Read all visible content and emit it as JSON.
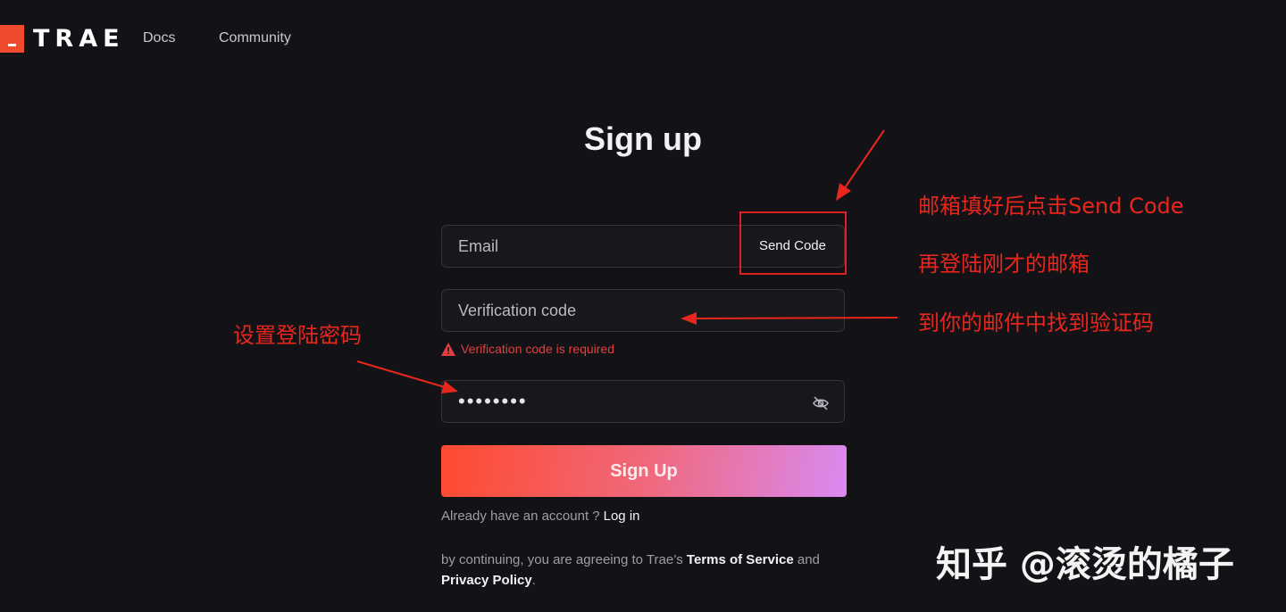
{
  "header": {
    "logo_text": "TRAE",
    "nav": [
      {
        "label": "Docs"
      },
      {
        "label": "Community"
      }
    ]
  },
  "form": {
    "title": "Sign up",
    "email_placeholder": "Email",
    "send_code_label": "Send Code",
    "code_placeholder": "Verification code",
    "code_error": "Verification code is required",
    "password_value": "••••••••",
    "submit_label": "Sign Up",
    "already_text": "Already have an account ?",
    "login_label": "Log in",
    "terms_prefix": "by continuing, you are agreeing to Trae’s ",
    "terms_link": "Terms of Service",
    "terms_and": " and",
    "privacy_link": "Privacy Policy",
    "terms_suffix": "."
  },
  "annotations": {
    "note_send_code": "邮箱填好后点击Send Code",
    "note_login_email": "再登陆刚才的邮箱",
    "note_find_code": "到你的邮件中找到验证码",
    "note_password": "设置登陆密码",
    "color": "#e8261e"
  },
  "watermark": "知乎 @滚烫的橘子",
  "colors": {
    "background": "#131317",
    "brand": "#f04a2f",
    "error": "#e0403f"
  }
}
